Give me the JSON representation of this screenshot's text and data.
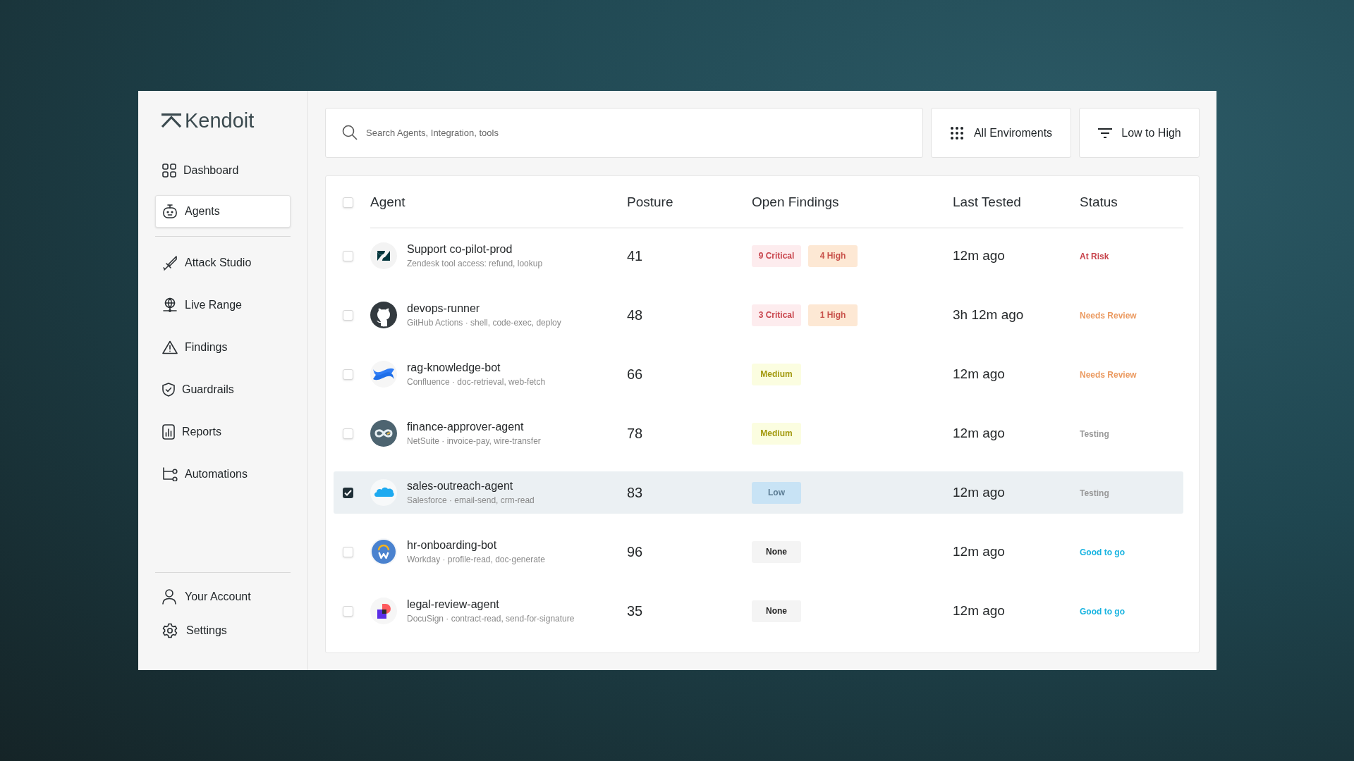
{
  "brand": {
    "name": "Kendoit"
  },
  "sidebar": {
    "items": [
      {
        "label": "Dashboard",
        "selected": false
      },
      {
        "label": "Agents",
        "selected": true
      },
      {
        "label": "Attack Studio",
        "selected": false
      },
      {
        "label": "Live Range",
        "selected": false
      },
      {
        "label": "Findings",
        "selected": false
      },
      {
        "label": "Guardrails",
        "selected": false
      },
      {
        "label": "Reports",
        "selected": false
      },
      {
        "label": "Automations",
        "selected": false
      }
    ],
    "footer_items": [
      {
        "label": "Your Account"
      },
      {
        "label": "Settings"
      }
    ]
  },
  "search": {
    "placeholder": "Search Agents, Integration, tools"
  },
  "environment_button": {
    "label": "All Enviroments"
  },
  "sort_button": {
    "label": "Low to High"
  },
  "table": {
    "select_all": {
      "checked": false
    },
    "columns": [
      "Agent",
      "Posture",
      "Open Findings",
      "Last Tested",
      "Status"
    ],
    "rows": [
      {
        "selected": false,
        "logo": {
          "kind": "zendesk"
        },
        "name": "Support co-pilot-prod",
        "detail": "Zendesk tool access: refund, lookup",
        "posture": "41",
        "findings": [
          {
            "label": "9 Critical",
            "kind": "critical"
          },
          {
            "label": "4 High",
            "kind": "high"
          }
        ],
        "last_tested": "12m ago",
        "status": {
          "label": "At Risk",
          "kind": "at_risk"
        }
      },
      {
        "selected": false,
        "logo": {
          "kind": "github"
        },
        "name": "devops-runner",
        "detail": "GitHub Actions · shell, code-exec, deploy",
        "posture": "48",
        "findings": [
          {
            "label": "3 Critical",
            "kind": "critical"
          },
          {
            "label": "1 High",
            "kind": "high"
          }
        ],
        "last_tested": "3h 12m ago",
        "status": {
          "label": "Needs Review",
          "kind": "needs_review"
        }
      },
      {
        "selected": false,
        "logo": {
          "kind": "confluence"
        },
        "name": "rag-knowledge-bot",
        "detail": "Confluence · doc-retrieval, web-fetch",
        "posture": "66",
        "findings": [
          {
            "label": "Medium",
            "kind": "medium"
          }
        ],
        "last_tested": "12m ago",
        "status": {
          "label": "Needs Review",
          "kind": "needs_review"
        }
      },
      {
        "selected": false,
        "logo": {
          "kind": "netsuite"
        },
        "name": "finance-approver-agent",
        "detail": "NetSuite · invoice-pay, wire-transfer",
        "posture": "78",
        "findings": [
          {
            "label": "Medium",
            "kind": "medium"
          }
        ],
        "last_tested": "12m ago",
        "status": {
          "label": "Testing",
          "kind": "testing"
        }
      },
      {
        "selected": true,
        "logo": {
          "kind": "salesforce"
        },
        "name": "sales-outreach-agent",
        "detail": "Salesforce · email-send, crm-read",
        "posture": "83",
        "findings": [
          {
            "label": "Low",
            "kind": "low"
          }
        ],
        "last_tested": "12m ago",
        "status": {
          "label": "Testing",
          "kind": "testing"
        }
      },
      {
        "selected": false,
        "logo": {
          "kind": "workday"
        },
        "name": "hr-onboarding-bot",
        "detail": "Workday · profile-read, doc-generate",
        "posture": "96",
        "findings": [
          {
            "label": "None",
            "kind": "none"
          }
        ],
        "last_tested": "12m ago",
        "status": {
          "label": "Good to go",
          "kind": "good"
        }
      },
      {
        "selected": false,
        "logo": {
          "kind": "docusign"
        },
        "name": "legal-review-agent",
        "detail": "DocuSign · contract-read, send-for-signature",
        "posture": "35",
        "findings": [
          {
            "label": "None",
            "kind": "none"
          }
        ],
        "last_tested": "12m ago",
        "status": {
          "label": "Good to go",
          "kind": "good"
        }
      }
    ]
  }
}
